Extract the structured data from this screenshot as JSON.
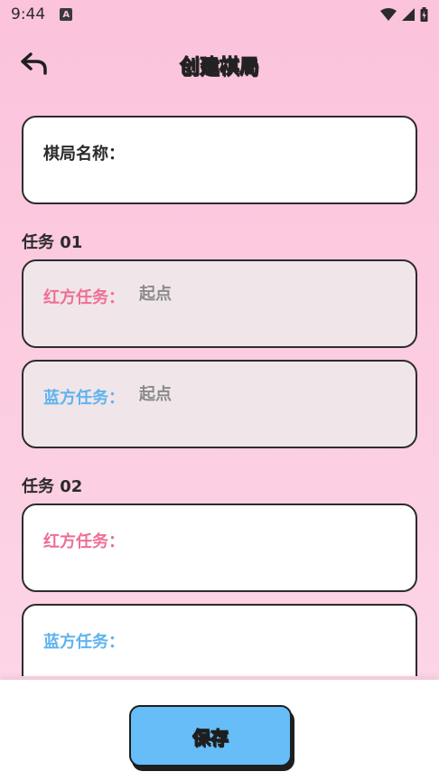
{
  "status": {
    "time": "9:44",
    "notification_icon": "A"
  },
  "header": {
    "title": "创建棋局",
    "back_icon": "back-arrow-icon"
  },
  "game_name": {
    "label": "棋局名称：",
    "value": ""
  },
  "tasks": [
    {
      "title": "任务 01",
      "red": {
        "label": "红方任务：",
        "value": "起点"
      },
      "blue": {
        "label": "蓝方任务：",
        "value": "起点"
      }
    },
    {
      "title": "任务 02",
      "red": {
        "label": "红方任务：",
        "value": ""
      },
      "blue": {
        "label": "蓝方任务：",
        "value": ""
      }
    }
  ],
  "footer": {
    "save_label": "保存"
  },
  "colors": {
    "background": "#fbc3dc",
    "red_label": "#ef6f96",
    "blue_label": "#5fb3ee",
    "save_button": "#66bdf8",
    "filled_card": "#f0e6e9"
  }
}
